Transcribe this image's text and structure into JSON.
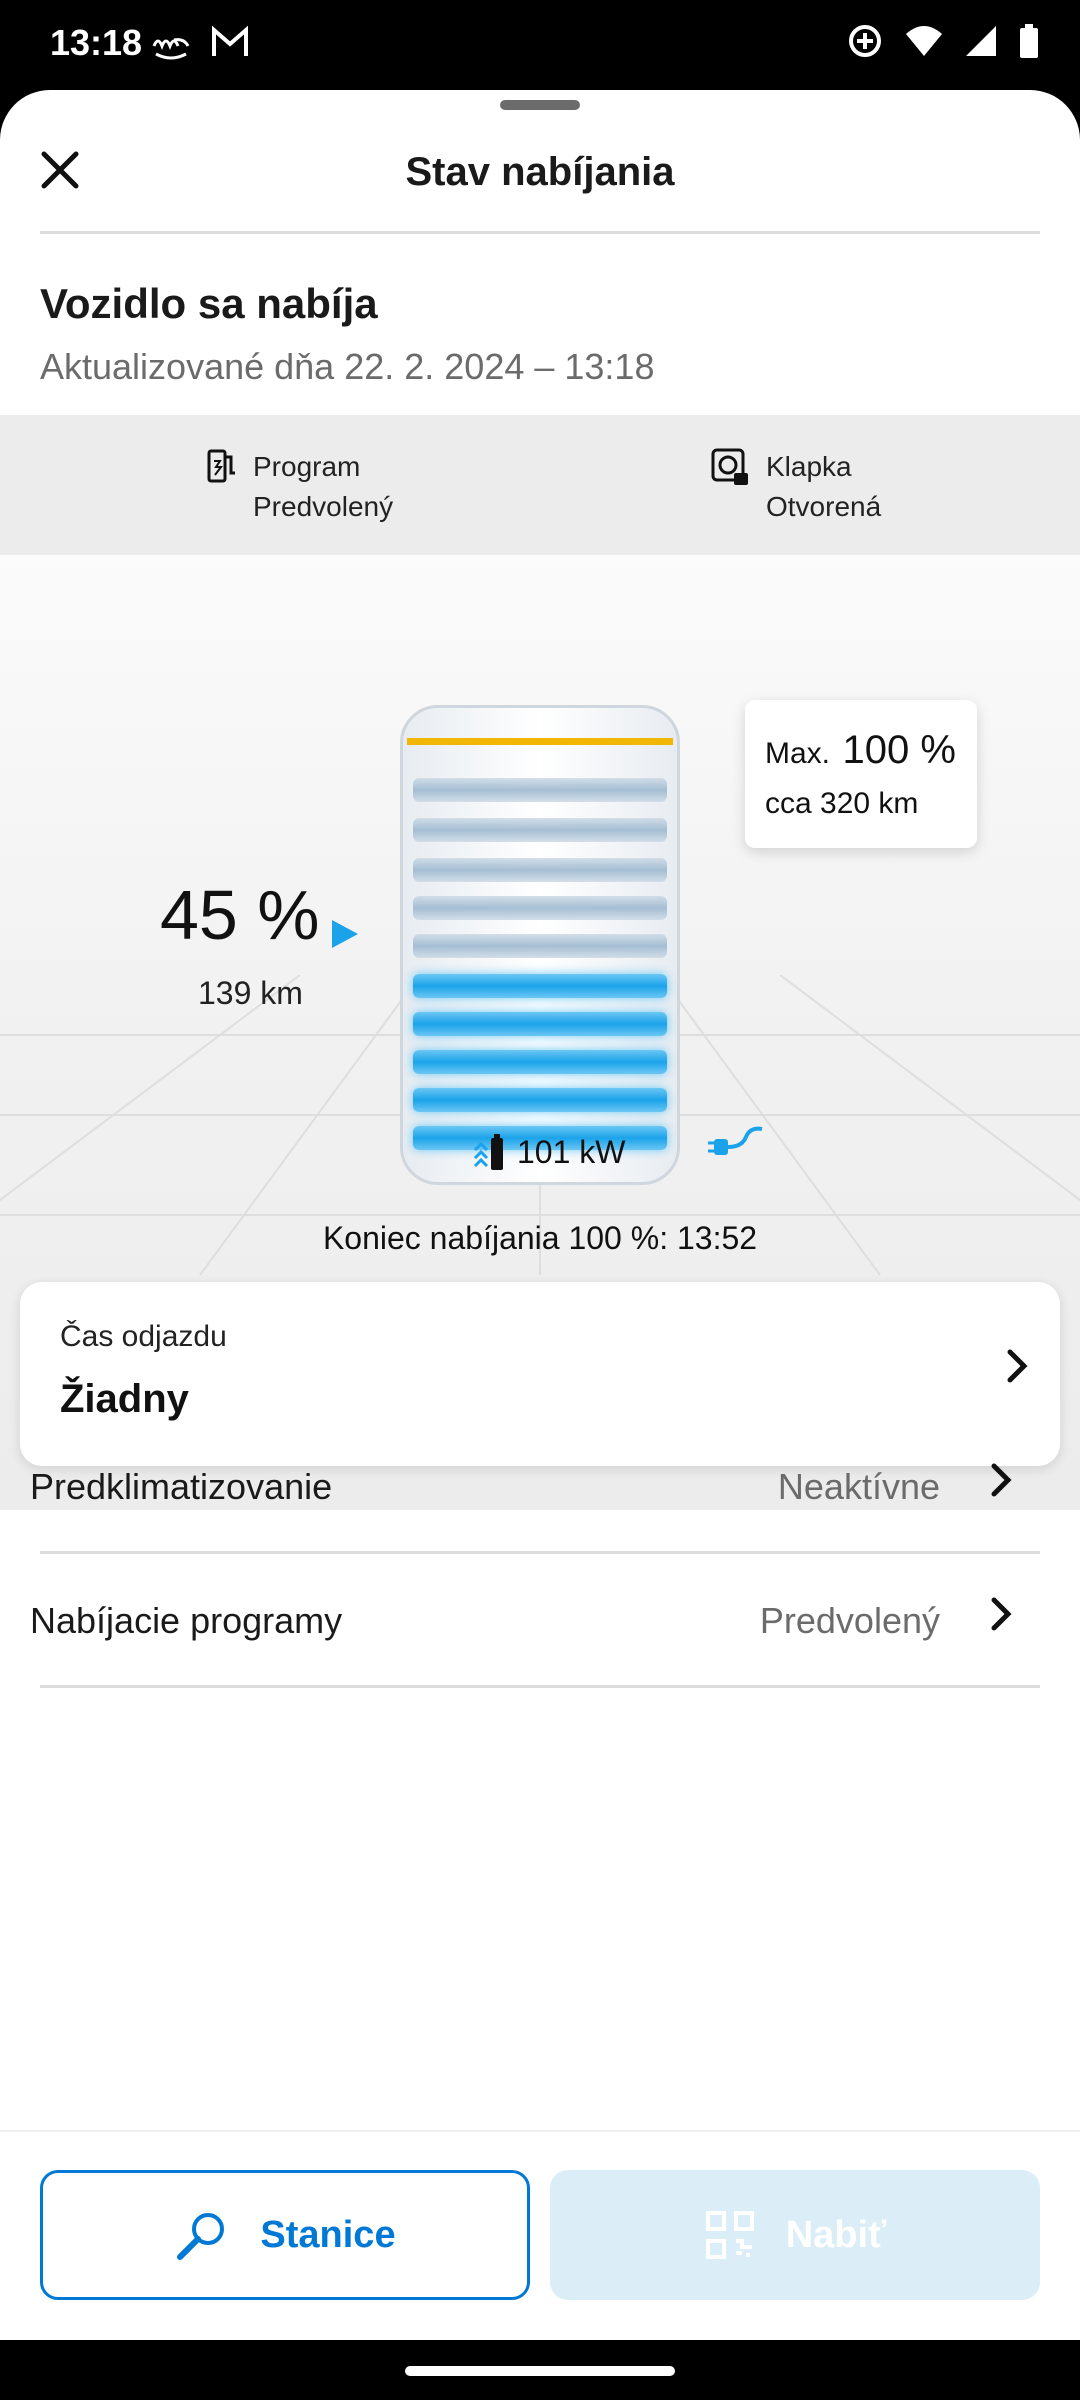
{
  "status_bar": {
    "time": "13:18",
    "left_icons": [
      "me-app-icon",
      "gmail-icon"
    ],
    "right_icons": [
      "data-saver-icon",
      "wifi-icon",
      "signal-icon",
      "battery-icon"
    ]
  },
  "header": {
    "title": "Stav nabíjania",
    "close_icon": "close-icon"
  },
  "summary": {
    "title": "Vozidlo sa nabíja",
    "updated": "Aktualizované dňa 22. 2. 2024 – 13:18"
  },
  "info": {
    "program_label": "Program",
    "program_value": "Predvolený",
    "flap_label": "Klapka",
    "flap_value": "Otvorená"
  },
  "battery": {
    "soc": "45 %",
    "range": "139 km",
    "state_of_charge_percent": 45,
    "max_target_percent": 100,
    "max_label": "Max.",
    "max_value": "100 %",
    "max_range": "cca 320 km",
    "power": "101 kW",
    "end_of_charge": "Koniec nabíjania 100 %: 13:52",
    "accent_color": "#1aa3ea",
    "max_line_color": "#f2b705"
  },
  "departure": {
    "label": "Čas odjazdu",
    "value": "Žiadny"
  },
  "rows": [
    {
      "label": "Predklimatizovanie",
      "value": "Neaktívne"
    },
    {
      "label": "Nabíjacie programy",
      "value": "Predvolený"
    }
  ],
  "actions": {
    "stations_label": "Stanice",
    "charge_label": "Nabiť",
    "brand_color": "#0078d6"
  }
}
